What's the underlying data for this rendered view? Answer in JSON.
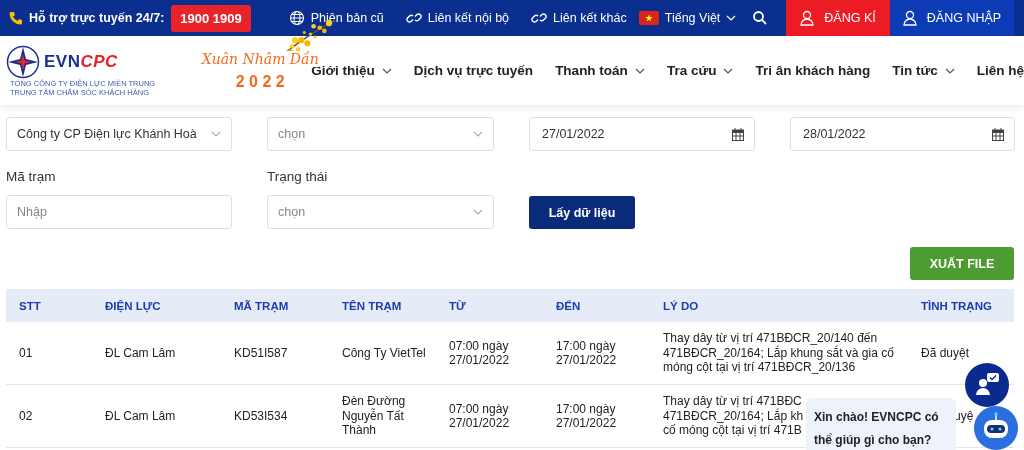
{
  "top_bar": {
    "hotline_label": "Hỗ trợ trực tuyến 24/7:",
    "hotline_number": "1900 1909",
    "links": [
      {
        "kind": "globe",
        "label": "Phiên bản cũ"
      },
      {
        "kind": "link",
        "label": "Liên kết nội bộ"
      },
      {
        "kind": "link",
        "label": "Liên kết khác"
      }
    ],
    "language": "Tiếng Việt",
    "register": "ĐĂNG KÍ",
    "login": "ĐĂNG NHẬP"
  },
  "header": {
    "logo": {
      "brand_dark": "EVN",
      "brand_red": "CPC",
      "line_1": "TỔNG CÔNG TY ĐIỆN LỰC MIỀN TRUNG",
      "line_2": "TRUNG TÂM CHĂM SÓC KHÁCH HÀNG"
    },
    "festive": {
      "title": "Xuân Nhâm Dần",
      "year": "2 0 2 2"
    },
    "nav": [
      {
        "label": "Giới thiệu",
        "dropdown": true
      },
      {
        "label": "Dịch vụ trực tuyến",
        "dropdown": false
      },
      {
        "label": "Thanh toán",
        "dropdown": true
      },
      {
        "label": "Tra cứu",
        "dropdown": true
      },
      {
        "label": "Tri ân khách hàng",
        "dropdown": false
      },
      {
        "label": "Tin tức",
        "dropdown": true
      },
      {
        "label": "Liên hệ",
        "dropdown": false
      }
    ]
  },
  "form": {
    "fields": [
      {
        "kind": "select",
        "value": "Công ty CP Điện lực Khánh Hoà"
      },
      {
        "kind": "select",
        "placeholder": "chọn"
      },
      {
        "kind": "date",
        "value": "27/01/2022"
      },
      {
        "kind": "date",
        "value": "28/01/2022"
      },
      {
        "kind": "text",
        "label": "Mã trạm",
        "placeholder": "Nhập"
      },
      {
        "kind": "select",
        "label": "Trạng thái",
        "placeholder": "chọn"
      }
    ],
    "submit": "Lấy dữ liệu",
    "export": "XUẤT FILE"
  },
  "table": {
    "columns": [
      "STT",
      "ĐIỆN LỰC",
      "MÃ TRẠM",
      "TÊN TRẠM",
      "TỪ",
      "ĐẾN",
      "LÝ DO",
      "TÌNH TRẠNG"
    ],
    "rows": [
      [
        "01",
        "ĐL Cam Lâm",
        "KD51I587",
        "Công Ty VietTel",
        "07:00 ngày 27/01/2022",
        "17:00 ngày 27/01/2022",
        "Thay dây từ vị trí 471BĐCR_20/140 đến 471BĐCR_20/164; Lắp khung sắt và gia cố móng cột tại vị trí 471BĐCR_20/136",
        "Đã duyệt"
      ],
      [
        "02",
        "ĐL Cam Lâm",
        "KD53I534",
        "Đèn Đường Nguyễn Tất Thành",
        "07:00 ngày 27/01/2022",
        "17:00 ngày 27/01/2022",
        "Thay dây từ vị trí 471BĐC\n471BĐCR_20/164; Lắp kh\ncố móng cột tại vị trí 471B",
        "uyệ"
      ]
    ]
  },
  "chat": {
    "greeting": "Xin chào! EVNCPC có thể giúp gì cho bạn?"
  }
}
